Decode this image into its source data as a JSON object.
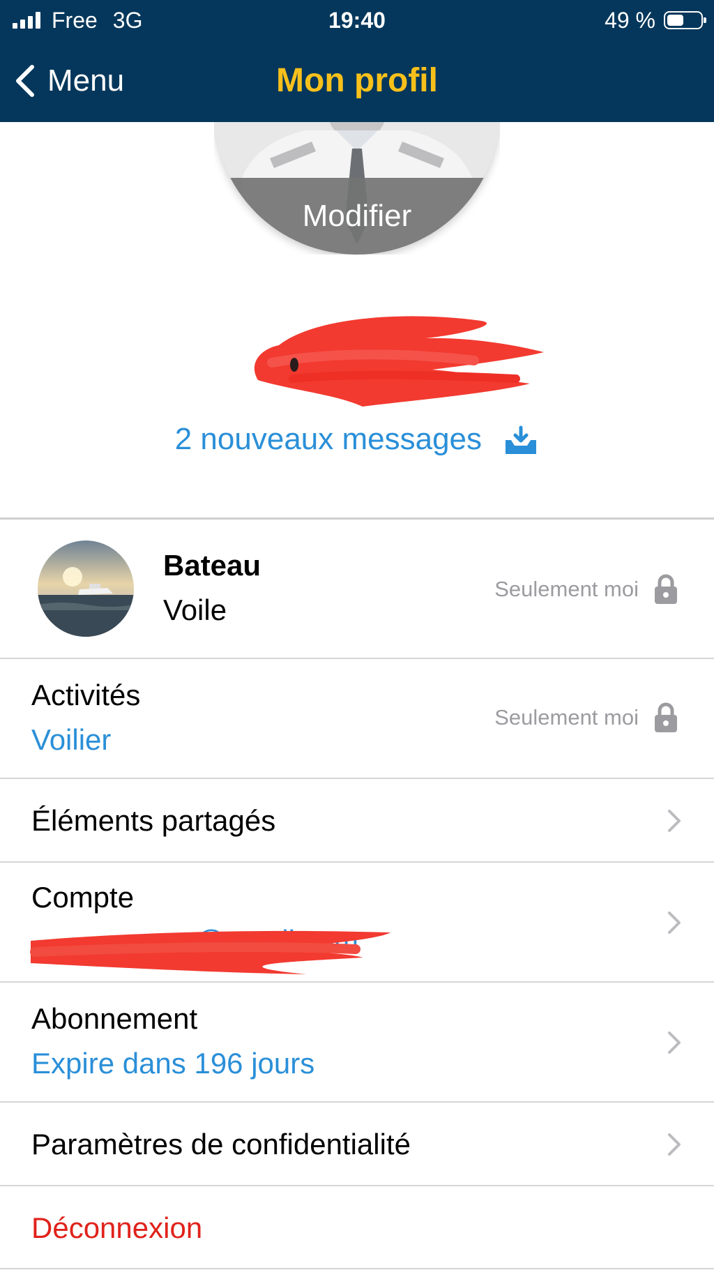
{
  "status_bar": {
    "carrier": "Free",
    "network": "3G",
    "time": "19:40",
    "battery": "49 %",
    "battery_level": 0.49
  },
  "nav": {
    "back_label": "Menu",
    "title": "Mon profil",
    "title_color": "#f8c01b",
    "bar_color": "#04375b"
  },
  "avatar": {
    "edit_label": "Modifier"
  },
  "messages": {
    "label": "2 nouveaux messages",
    "icon": "inbox-download-icon"
  },
  "boat": {
    "name": "Bateau",
    "type": "Voile",
    "visibility": "Seulement moi",
    "icon": "lock-icon"
  },
  "activities": {
    "label": "Activités",
    "value": "Voilier",
    "visibility": "Seulement moi"
  },
  "shared": {
    "label": "Éléments partagés"
  },
  "account": {
    "label": "Compte",
    "email_visible_part": "@gmail.com"
  },
  "subscription": {
    "label": "Abonnement",
    "value": "Expire dans 196 jours"
  },
  "privacy_settings": {
    "label": "Paramètres de confidentialité"
  },
  "logout": {
    "label": "Déconnexion",
    "color": "#e0221b"
  },
  "colors": {
    "accent_blue": "#2a8fd8",
    "muted_gray": "#9b9ba0",
    "redaction_red": "#f23a30"
  }
}
